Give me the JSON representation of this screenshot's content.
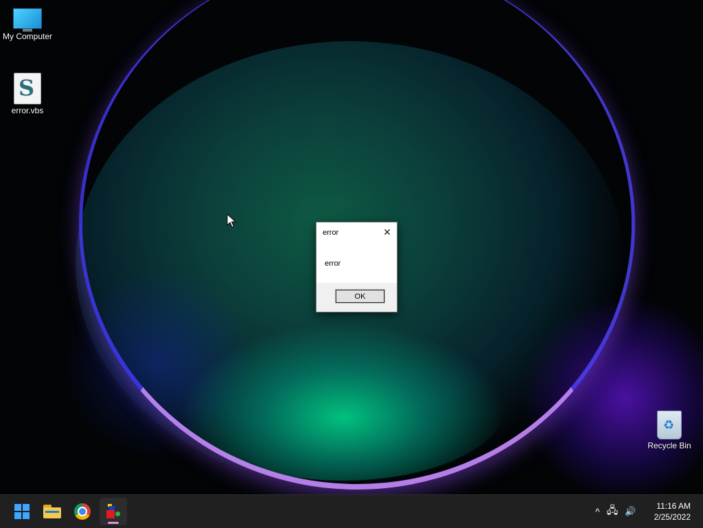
{
  "desktop": {
    "icons": [
      {
        "label": "My Computer"
      },
      {
        "label": "error.vbs"
      },
      {
        "label": "Recycle Bin"
      }
    ]
  },
  "dialog": {
    "title": "error",
    "message": "error",
    "ok_label": "OK",
    "close_glyph": "✕"
  },
  "taskbar": {
    "apps": [
      {
        "name": "start-icon"
      },
      {
        "name": "file-explorer-icon"
      },
      {
        "name": "chrome-icon"
      },
      {
        "name": "app-icon",
        "active": true
      }
    ],
    "tray": {
      "chevron": "^",
      "network_glyph": "🖧",
      "volume_glyph": "🔊"
    },
    "clock": {
      "time": "11:16 AM",
      "date": "2/25/2022"
    }
  },
  "colors": {
    "taskbar": "#202020",
    "accent": "#3ea7ff",
    "active_indicator": "#d497e0"
  }
}
